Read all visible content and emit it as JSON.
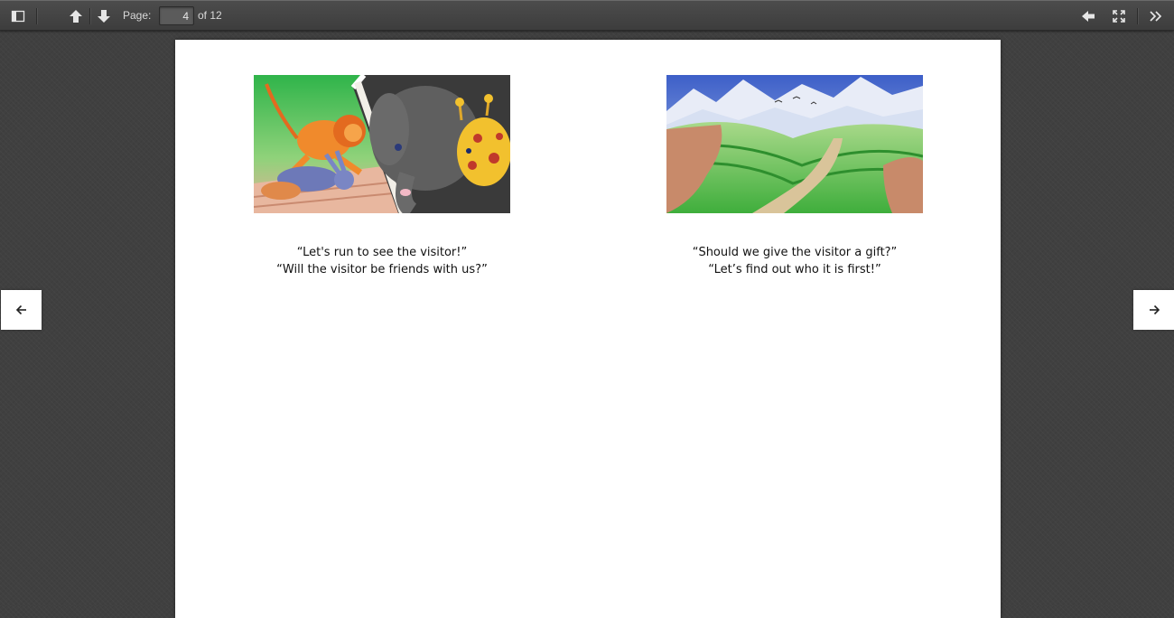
{
  "toolbar": {
    "sidebar_toggle_icon": "sidebar-toggle-icon",
    "prev_page_icon": "arrow-up-icon",
    "next_page_icon": "arrow-down-icon",
    "page_label": "Page:",
    "page_number": "4",
    "page_count_text": "of 12",
    "presentation_back_icon": "arrow-left-icon",
    "fullscreen_icon": "fullscreen-icon",
    "tools_icon": "double-chevron-right-icon"
  },
  "document": {
    "left_page": {
      "illustration": "animals-running-illustration",
      "caption_line1": "“Let's run to see the visitor!”",
      "caption_line2": "“Will the visitor be friends with us?”"
    },
    "right_page": {
      "illustration": "valley-landscape-illustration",
      "caption_line1": "“Should we give the visitor a gift?”",
      "caption_line2": "“Let’s find out who it is first!”"
    }
  },
  "navigation": {
    "prev_icon": "arrow-left-icon",
    "next_icon": "arrow-right-icon"
  },
  "colors": {
    "viewer_background": "#404040",
    "toolbar": "#464646",
    "page": "#ffffff"
  }
}
